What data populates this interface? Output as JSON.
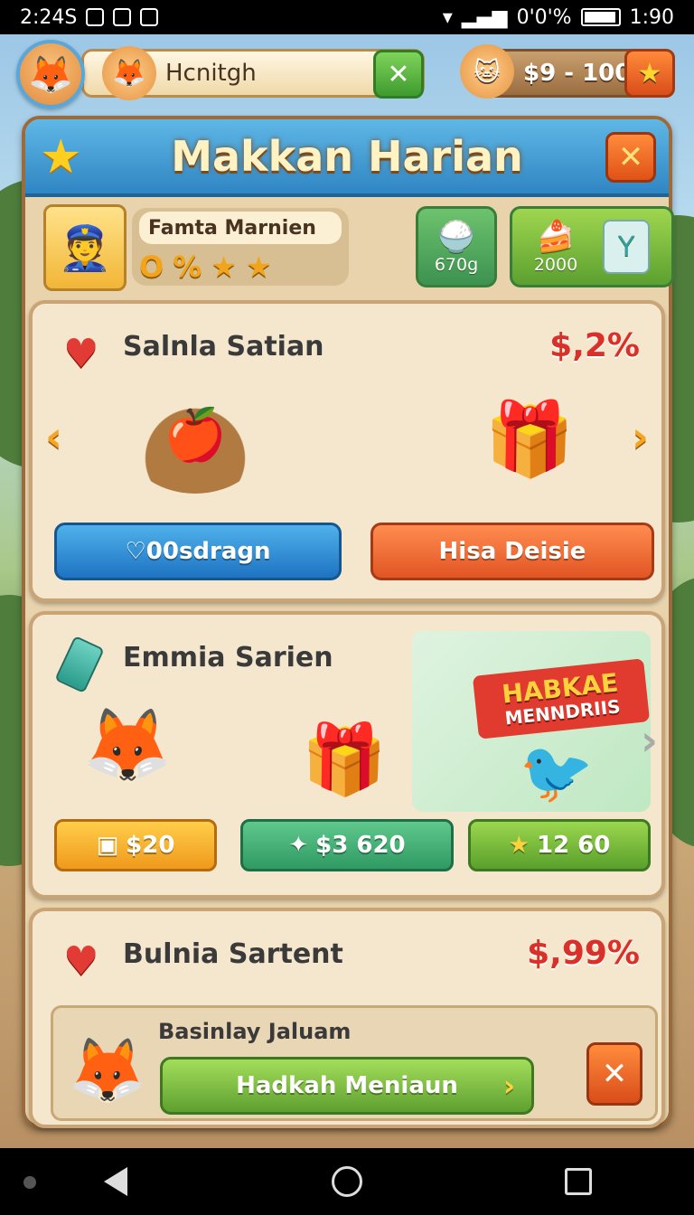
{
  "status_bar": {
    "time_left": "2:24S",
    "battery_pct": "0'0'%",
    "time_right": "1:90"
  },
  "header": {
    "username": "Hcnitgh",
    "money": "$9 - 100"
  },
  "panel": {
    "title": "Makkan Harian",
    "player": {
      "name": "Famta Marnien",
      "badges": [
        "O",
        "%",
        "★",
        "★"
      ]
    },
    "stats": [
      {
        "value": "670g",
        "icon": "rice-bowl-icon"
      },
      {
        "value": "2000",
        "icon": "cake-icon"
      }
    ]
  },
  "card1": {
    "title": "Salnla Satian",
    "percent": "$,2%",
    "left_button": "00sdragn",
    "right_button": "Hisa Deisie"
  },
  "card2": {
    "title": "Emmia Sarien",
    "promo_line1": "HABKAE",
    "promo_line2": "MENNDRIIS",
    "buttons": [
      "$20",
      "$3 620",
      "12 60"
    ]
  },
  "card3": {
    "title": "Bulnia Sartent",
    "percent": "$,99%",
    "sub_title": "Basinlay Jaluam",
    "sub_button": "Hadkah Meniaun"
  }
}
